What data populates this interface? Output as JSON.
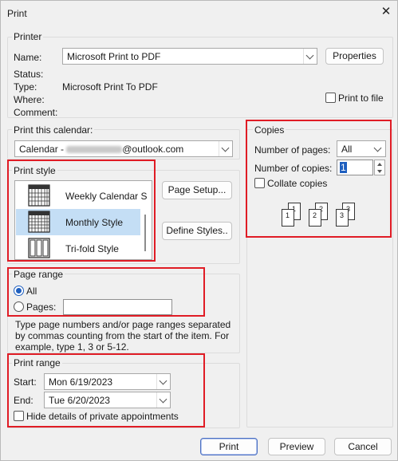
{
  "window": {
    "title": "Print",
    "close_glyph": "✕"
  },
  "printer": {
    "group_label": "Printer",
    "name_label": "Name:",
    "name_value": "Microsoft Print to PDF",
    "properties_button": "Properties",
    "status_label": "Status:",
    "type_label": "Type:",
    "type_value": "Microsoft Print To PDF",
    "where_label": "Where:",
    "comment_label": "Comment:",
    "print_to_file_label": "Print to file"
  },
  "calendar": {
    "group_label": "Print this calendar:",
    "value_prefix": "Calendar - ",
    "value_suffix": "@outlook.com"
  },
  "print_style": {
    "group_label": "Print style",
    "items": [
      {
        "label": "Weekly Calendar S",
        "icon": "weekly-calendar-icon",
        "selected": false
      },
      {
        "label": "Monthly Style",
        "icon": "monthly-calendar-icon",
        "selected": true
      },
      {
        "label": "Tri-fold Style",
        "icon": "trifold-icon",
        "selected": false
      }
    ],
    "page_setup_button": "Page Setup...",
    "define_styles_button": "Define Styles.."
  },
  "copies": {
    "group_label": "Copies",
    "pages_label": "Number of pages:",
    "pages_value": "All",
    "copies_label": "Number of copies:",
    "copies_value": "1",
    "collate_label": "Collate copies",
    "page_numbers": [
      "1",
      "1",
      "2",
      "2",
      "3",
      "3"
    ]
  },
  "page_range": {
    "group_label": "Page range",
    "all_label": "All",
    "pages_label": "Pages:",
    "pages_value": "",
    "description": "Type page numbers and/or page ranges separated by commas counting from the start of the item.  For example, type 1, 3 or 5-12."
  },
  "print_range": {
    "group_label": "Print range",
    "start_label": "Start:",
    "start_value": "Mon 6/19/2023",
    "end_label": "End:",
    "end_value": "Tue 6/20/2023",
    "hide_details_label": "Hide details of private appointments"
  },
  "footer": {
    "print_button": "Print",
    "preview_button": "Preview",
    "cancel_button": "Cancel"
  },
  "colors": {
    "highlight": "#e01c25",
    "selection": "#c4def5",
    "accent": "#1e5fbf"
  }
}
